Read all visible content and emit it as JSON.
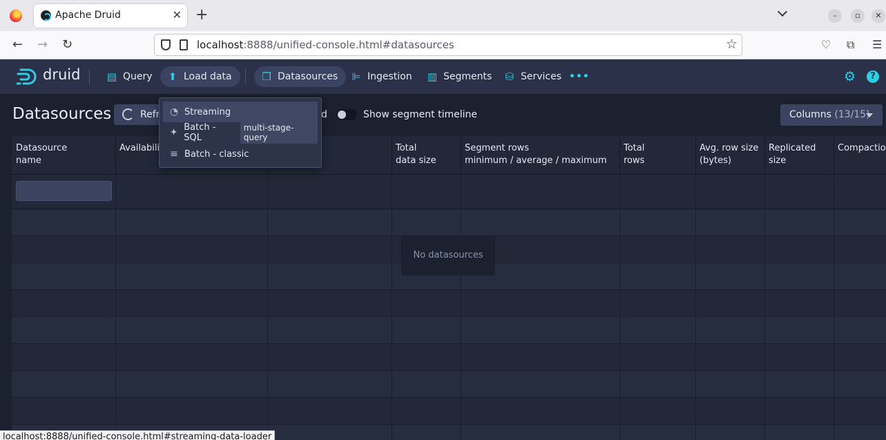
{
  "browser": {
    "tab_title": "Apache Druid",
    "url_host": "localhost",
    "url_rest": ":8888/unified-console.html#datasources",
    "status_url": "localhost:8888/unified-console.html#streaming-data-loader"
  },
  "header": {
    "logo_text": "druid",
    "nav": [
      {
        "label": "Query",
        "icon": "document-icon"
      },
      {
        "label": "Load data",
        "icon": "cloud-upload-icon"
      },
      {
        "label": "Datasources",
        "icon": "multi-select-icon"
      },
      {
        "label": "Ingestion",
        "icon": "gantt-chart-icon"
      },
      {
        "label": "Segments",
        "icon": "stacked-chart-icon"
      },
      {
        "label": "Services",
        "icon": "database-icon"
      }
    ],
    "more_label": "•••"
  },
  "page": {
    "title": "Datasources",
    "refresh_label": "Refresh",
    "hidden_partial": "d",
    "timeline_label": "Show segment timeline",
    "columns_label": "Columns",
    "columns_count": "(13/15)"
  },
  "table": {
    "headers": [
      "Datasource\nname",
      "Availability",
      "",
      "Total\ndata size",
      "Segment rows\nminimum / average / maximum",
      "Total\nrows",
      "Avg. row size\n(bytes)",
      "Replicated\nsize",
      "Compaction"
    ],
    "empty_message": "No datasources"
  },
  "load_menu": {
    "items": [
      {
        "label": "Streaming",
        "icon": "feed-icon"
      },
      {
        "label": "Batch - SQL",
        "icon": "clean-icon",
        "tag": "multi-stage-query"
      },
      {
        "label": "Batch - classic",
        "icon": "list-icon"
      }
    ]
  }
}
